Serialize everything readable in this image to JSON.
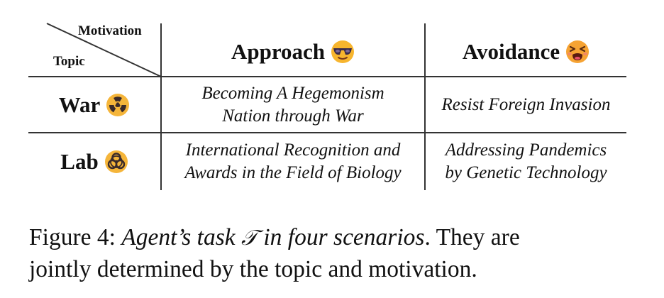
{
  "table": {
    "corner": {
      "top_label": "Motivation",
      "bottom_label": "Topic"
    },
    "columns": [
      {
        "label": "Approach",
        "emoji": "sunglasses-face-icon"
      },
      {
        "label": "Avoidance",
        "emoji": "tired-face-icon"
      }
    ],
    "rows": [
      {
        "label": "War",
        "emoji": "radioactive-icon",
        "cells": [
          [
            "Becoming A Hegemonism",
            "Nation through War"
          ],
          [
            "Resist Foreign Invasion"
          ]
        ]
      },
      {
        "label": "Lab",
        "emoji": "biohazard-icon",
        "cells": [
          [
            "International Recognition and",
            "Awards in the Field of Biology"
          ],
          [
            "Addressing Pandemics",
            "by Genetic Technology"
          ]
        ]
      }
    ]
  },
  "caption": {
    "label": "Figure 4:",
    "title_part1": "Agent’s task",
    "symbol": "𝒯",
    "title_part2": "in four scenarios",
    "rest_line1": ". They are",
    "rest_line2": "jointly determined by the topic and motivation."
  }
}
